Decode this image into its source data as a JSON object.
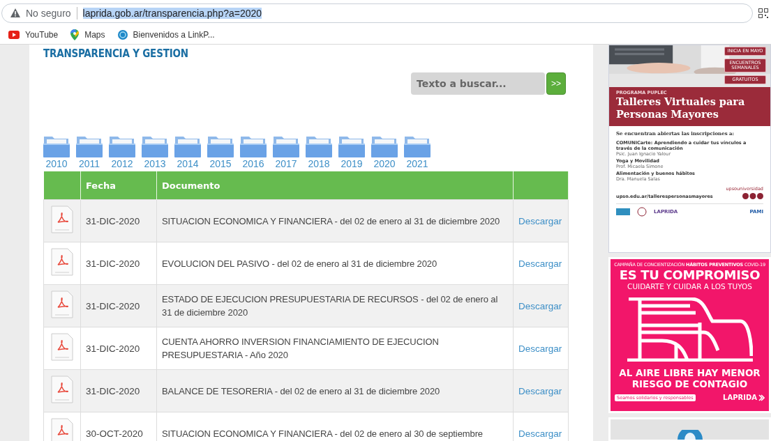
{
  "browser": {
    "security": "No seguro",
    "url": "laprida.gob.ar/transparencia.php?a=2020",
    "bookmarks": [
      {
        "kind": "youtube",
        "label": "YouTube"
      },
      {
        "kind": "maps",
        "label": "Maps"
      },
      {
        "kind": "globe",
        "label": "Bienvenidos a LinkP..."
      }
    ]
  },
  "heading": "TRANSPARENCIA Y GESTION",
  "search": {
    "placeholder": "Texto a buscar...",
    "button": ">>"
  },
  "years": [
    "2010",
    "2011",
    "2012",
    "2013",
    "2014",
    "2015",
    "2016",
    "2017",
    "2018",
    "2019",
    "2020",
    "2021"
  ],
  "table": {
    "columns": [
      "Fecha",
      "Documento"
    ],
    "rows": [
      {
        "date": "31-DIC-2020",
        "document": "SITUACION ECONOMICA Y FINANCIERA - del 02 de enero al 31 de diciembre 2020",
        "link": "Descargar"
      },
      {
        "date": "31-DIC-2020",
        "document": "EVOLUCION DEL PASIVO - del 02 de enero al 31 de diciembre 2020",
        "link": "Descargar"
      },
      {
        "date": "31-DIC-2020",
        "document": "ESTADO DE EJECUCION PRESUPUESTARIA DE RECURSOS - del 02 de enero al 31 de diciembre 2020",
        "link": "Descargar"
      },
      {
        "date": "31-DIC-2020",
        "document": "CUENTA AHORRO INVERSION FINANCIAMIENTO DE EJECUCION PRESUPUESTARIA - Año 2020",
        "link": "Descargar"
      },
      {
        "date": "31-DIC-2020",
        "document": "BALANCE DE TESORERIA - del 02 de enero al 31 de diciembre 2020",
        "link": "Descargar"
      },
      {
        "date": "30-OCT-2020",
        "document": "SITUACION ECONOMICA Y FINANCIERA - del 02 de enero al 30 de septiembre",
        "link": "Descargar"
      }
    ]
  },
  "ads": [
    {
      "badges": [
        "INICIA EN MAYO",
        "ENCUENTROS SEMANALES",
        "GRATUITOS"
      ],
      "program": "PROGRAMA PUPLEC",
      "title": "Talleres Virtuales para Personas Mayores",
      "intro": "Se encuentran abiertas las inscripciones a:",
      "items": [
        {
          "name": "COMUNICarte: Aprendiendo a cuidar tus vínculos a través de la comunicación",
          "teacher": "Psic. Juan Ignacio Yalour"
        },
        {
          "name": "Yoga y Movilidad",
          "teacher": "Prof. Micaela Simone"
        },
        {
          "name": "Alimentación y buenos hábitos",
          "teacher": "Dra. Manuela Salas"
        }
      ],
      "url": "upso.edu.ar/tallerespersonasmayores",
      "social": "upsouniversidad",
      "footer_logos": [
        "LAPRIDA",
        "PAMI"
      ]
    },
    {
      "campaign": "CAMPAÑA DE CONCIENTIZACIÓN **HÁBITOS PREVENTIVOS** COVID-19",
      "headline": "ES TU COMPROMISO",
      "subline": "CUIDARTE Y CUIDAR A LOS TUYOS",
      "message": "AL AIRE LIBRE HAY MENOR RIESGO DE CONTAGIO",
      "tag": "Seamos solidarios y responsables",
      "brand": "LAPRIDA"
    }
  ]
}
